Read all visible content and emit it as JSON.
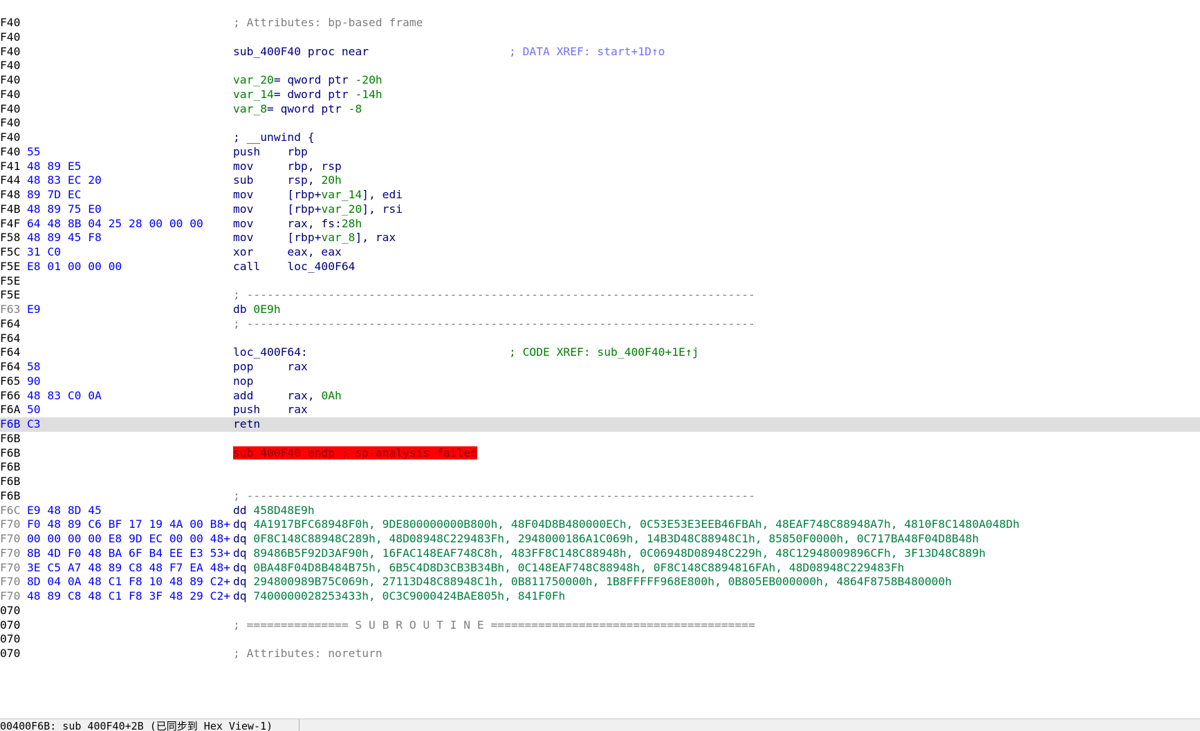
{
  "theme": {
    "background": "#ffffff",
    "address": "#000000",
    "address_dim": "#808080",
    "address_current": "#0000ff",
    "bytes": "#0000ff",
    "mnemonic": "#000080",
    "number": "#008000",
    "comment": "#808080",
    "data_xref": "#7070ff",
    "error_highlight": "#ff0000",
    "current_line": "#dedede"
  },
  "lines": [
    {
      "addr": "F40",
      "bytes": "",
      "segs": [
        [
          "t-cmt",
          "; Attributes: bp-based frame"
        ]
      ]
    },
    {
      "addr": "F40",
      "bytes": "",
      "segs": []
    },
    {
      "addr": "F40",
      "bytes": "",
      "segs": [
        [
          "t-k",
          "sub_400F40 proc near"
        ]
      ],
      "xref": [
        [
          "t-xref-data",
          "; DATA XREF: start+1D↑o"
        ]
      ]
    },
    {
      "addr": "F40",
      "bytes": "",
      "segs": []
    },
    {
      "addr": "F40",
      "bytes": "",
      "segs": [
        [
          "t-v",
          "var_20"
        ],
        [
          "t-k",
          "= qword ptr "
        ],
        [
          "t-n",
          "-20h"
        ]
      ]
    },
    {
      "addr": "F40",
      "bytes": "",
      "segs": [
        [
          "t-v",
          "var_14"
        ],
        [
          "t-k",
          "= dword ptr "
        ],
        [
          "t-n",
          "-14h"
        ]
      ]
    },
    {
      "addr": "F40",
      "bytes": "",
      "segs": [
        [
          "t-v",
          "var_8"
        ],
        [
          "t-k",
          "= qword ptr "
        ],
        [
          "t-n",
          "-8"
        ]
      ]
    },
    {
      "addr": "F40",
      "bytes": "",
      "segs": []
    },
    {
      "addr": "F40",
      "bytes": "",
      "segs": [
        [
          "t-k",
          "; __unwind {"
        ]
      ]
    },
    {
      "addr": "F40",
      "bytes": "55",
      "segs": [
        [
          "t-k",
          "push    rbp"
        ]
      ]
    },
    {
      "addr": "F41",
      "bytes": "48 89 E5",
      "segs": [
        [
          "t-k",
          "mov     rbp, rsp"
        ]
      ]
    },
    {
      "addr": "F44",
      "bytes": "48 83 EC 20",
      "segs": [
        [
          "t-k",
          "sub     rsp, "
        ],
        [
          "t-n",
          "20h"
        ]
      ]
    },
    {
      "addr": "F48",
      "bytes": "89 7D EC",
      "segs": [
        [
          "t-k",
          "mov     [rbp+"
        ],
        [
          "t-v",
          "var_14"
        ],
        [
          "t-k",
          "], edi"
        ]
      ]
    },
    {
      "addr": "F4B",
      "bytes": "48 89 75 E0",
      "segs": [
        [
          "t-k",
          "mov     [rbp+"
        ],
        [
          "t-v",
          "var_20"
        ],
        [
          "t-k",
          "], rsi"
        ]
      ]
    },
    {
      "addr": "F4F",
      "bytes": "64 48 8B 04 25 28 00 00 00",
      "segs": [
        [
          "t-k",
          "mov     rax, fs:"
        ],
        [
          "t-n",
          "28h"
        ]
      ]
    },
    {
      "addr": "F58",
      "bytes": "48 89 45 F8",
      "segs": [
        [
          "t-k",
          "mov     [rbp+"
        ],
        [
          "t-v",
          "var_8"
        ],
        [
          "t-k",
          "], rax"
        ]
      ]
    },
    {
      "addr": "F5C",
      "bytes": "31 C0",
      "segs": [
        [
          "t-k",
          "xor     eax, eax"
        ]
      ]
    },
    {
      "addr": "F5E",
      "bytes": "E8 01 00 00 00",
      "segs": [
        [
          "t-k",
          "call    loc_400F64"
        ]
      ]
    },
    {
      "addr": "F5E",
      "bytes": "",
      "segs": []
    },
    {
      "addr": "F5E",
      "bytes": "",
      "segs": [
        [
          "t-cmt",
          "; ---------------------------------------------------------------------------"
        ]
      ]
    },
    {
      "addr": "F63",
      "bytes": "E9",
      "dim": true,
      "segs": [
        [
          "t-k",
          "db "
        ],
        [
          "t-n",
          "0E9h"
        ]
      ]
    },
    {
      "addr": "F64",
      "bytes": "",
      "segs": [
        [
          "t-cmt",
          "; ---------------------------------------------------------------------------"
        ]
      ]
    },
    {
      "addr": "F64",
      "bytes": "",
      "segs": []
    },
    {
      "addr": "F64",
      "bytes": "",
      "segs": [
        [
          "t-k",
          "loc_400F64:"
        ]
      ],
      "xref": [
        [
          "t-xref-code",
          "; CODE XREF: sub_400F40+1E↑j"
        ]
      ]
    },
    {
      "addr": "F64",
      "bytes": "58",
      "segs": [
        [
          "t-k",
          "pop     rax"
        ]
      ]
    },
    {
      "addr": "F65",
      "bytes": "90",
      "segs": [
        [
          "t-k",
          "nop"
        ]
      ]
    },
    {
      "addr": "F66",
      "bytes": "48 83 C0 0A",
      "segs": [
        [
          "t-k",
          "add     rax, "
        ],
        [
          "t-n",
          "0Ah"
        ]
      ]
    },
    {
      "addr": "F6A",
      "bytes": "50",
      "segs": [
        [
          "t-k",
          "push    rax"
        ]
      ]
    },
    {
      "addr": "F6B",
      "bytes": "C3",
      "current": true,
      "segs": [
        [
          "t-k",
          "retn"
        ]
      ]
    },
    {
      "addr": "F6B",
      "bytes": "",
      "segs": []
    },
    {
      "addr": "F6B",
      "bytes": "",
      "segs": [
        [
          "t-err",
          "sub_400F40 endp ; sp-analysis failed"
        ]
      ]
    },
    {
      "addr": "F6B",
      "bytes": "",
      "segs": []
    },
    {
      "addr": "F6B",
      "bytes": "",
      "segs": []
    },
    {
      "addr": "F6B",
      "bytes": "",
      "segs": [
        [
          "t-cmt",
          "; ---------------------------------------------------------------------------"
        ]
      ]
    },
    {
      "addr": "F6C",
      "bytes": "E9 48 8D 45",
      "dim": true,
      "segs": [
        [
          "t-k",
          "dd "
        ],
        [
          "t-g",
          "458D48E9h"
        ]
      ]
    },
    {
      "addr": "F70",
      "bytes": "F0 48 89 C6 BF 17 19 4A 00 B8+",
      "dim": true,
      "segs": [
        [
          "t-k",
          "dq "
        ],
        [
          "t-g",
          "4A1917BFC68948F0h, 9DE800000000B800h, 48F04D8B480000ECh, 0C53E53E3EEB46FBAh, 48EAF748C88948A7h, 4810F8C1480A048Dh"
        ]
      ]
    },
    {
      "addr": "F70",
      "bytes": "00 00 00 00 E8 9D EC 00 00 48+",
      "dim": true,
      "segs": [
        [
          "t-k",
          "dq "
        ],
        [
          "t-g",
          "0F8C148C88948C289h, 48D08948C229483Fh, 2948000186A1C069h, 14B3D48C88948C1h, 85850F0000h, 0C717BA48F04D8B48h"
        ]
      ]
    },
    {
      "addr": "F70",
      "bytes": "8B 4D F0 48 BA 6F B4 EE E3 53+",
      "dim": true,
      "segs": [
        [
          "t-k",
          "dq "
        ],
        [
          "t-g",
          "89486B5F92D3AF90h, 16FAC148EAF748C8h, 483FF8C148C88948h, 0C06948D08948C229h, 48C12948009896CFh, 3F13D48C889h"
        ]
      ]
    },
    {
      "addr": "F70",
      "bytes": "3E C5 A7 48 89 C8 48 F7 EA 48+",
      "dim": true,
      "segs": [
        [
          "t-k",
          "dq "
        ],
        [
          "t-g",
          "0BA48F04D8B484B75h, 6B5C4D8D3CB3B34Bh, 0C148EAF748C88948h, 0F8C148C8894816FAh, 48D08948C229483Fh"
        ]
      ]
    },
    {
      "addr": "F70",
      "bytes": "8D 04 0A 48 C1 F8 10 48 89 C2+",
      "dim": true,
      "segs": [
        [
          "t-k",
          "dq "
        ],
        [
          "t-g",
          "294800989B75C069h, 27113D48C88948C1h, 0B811750000h, 1B8FFFFF968E800h, 0B805EB000000h, 4864F8758B480000h"
        ]
      ]
    },
    {
      "addr": "F70",
      "bytes": "48 89 C8 48 C1 F8 3F 48 29 C2+",
      "dim": true,
      "segs": [
        [
          "t-k",
          "dq "
        ],
        [
          "t-g",
          "7400000028253433h, 0C3C9000424BAE805h, 841F0Fh"
        ]
      ]
    },
    {
      "addr": "070",
      "bytes": "",
      "segs": []
    },
    {
      "addr": "070",
      "bytes": "",
      "segs": [
        [
          "t-cmt",
          "; =============== S U B R O U T I N E ======================================="
        ]
      ]
    },
    {
      "addr": "070",
      "bytes": "",
      "segs": []
    },
    {
      "addr": "070",
      "bytes": "",
      "segs": [
        [
          "t-cmt",
          "; Attributes: noreturn"
        ]
      ]
    }
  ],
  "status_bar": {
    "text": "00400F6B: sub_400F40+2B (已同步到 Hex View-1)"
  }
}
